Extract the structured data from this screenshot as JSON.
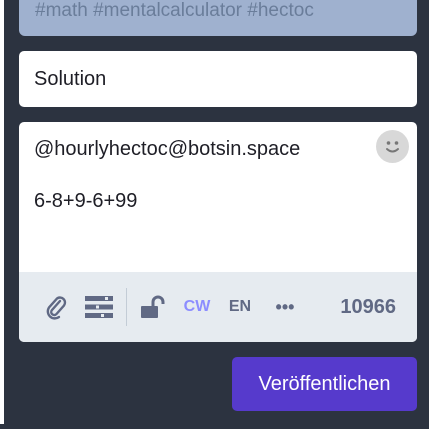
{
  "prev_field": {
    "text": "#math #mentalcalculator #hectoc"
  },
  "content_warning": {
    "value": "Solution"
  },
  "compose": {
    "lines": [
      "@hourlyhectoc@botsin.space",
      "",
      "6-8+9-6+99"
    ],
    "emoji_icon": "smiley-icon"
  },
  "toolbar": {
    "attach_icon": "paperclip-icon",
    "poll_icon": "poll-icon",
    "privacy_icon": "unlock-icon",
    "cw_label": "CW",
    "lang_label": "EN",
    "more_label": "•••",
    "counter": "10966"
  },
  "publish": {
    "label": "Veröffentlichen"
  },
  "colors": {
    "panel": "#2c3340",
    "accent": "#563acc",
    "cw_active": "#8c8dff",
    "toolbar_bg": "#e6ebf0",
    "icon": "#606984"
  }
}
